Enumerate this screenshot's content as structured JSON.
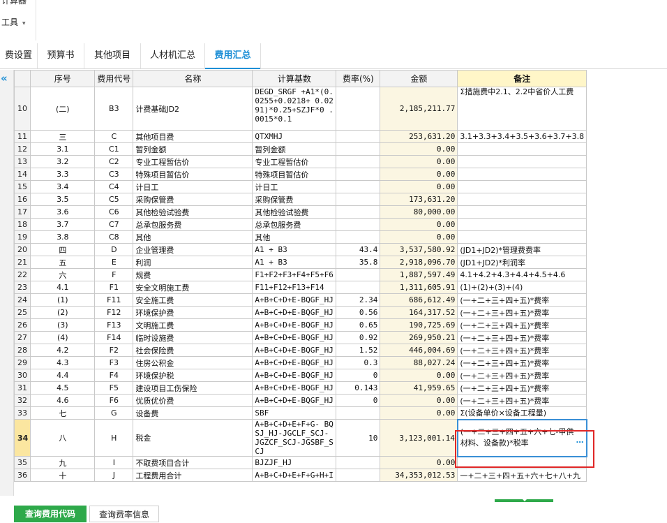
{
  "ribbon": {
    "cut_label": "计算器",
    "tools_label": "工具",
    "tools_caret": "▾"
  },
  "tabs": [
    {
      "label": "费设置"
    },
    {
      "label": "预算书"
    },
    {
      "label": "其他项目"
    },
    {
      "label": "人材机汇总"
    },
    {
      "label": "费用汇总"
    }
  ],
  "collapse_icon": "«",
  "grid": {
    "headers": [
      "序号",
      "费用代号",
      "名称",
      "计算基数",
      "费率(%)",
      "金额",
      "备注"
    ],
    "rows": [
      {
        "rn": "10",
        "seq": "(二)",
        "code": "B3",
        "name": "计费基础JD2",
        "base": "DEGD_SRGF +A1*(0.0255+0.0218+ 0.0291)*0.25+SZJF*0 .0015*0.1",
        "rate": "",
        "amount": "2,185,211.77",
        "remark": "Σ措施费中2.1、2.2中省价人工费"
      },
      {
        "rn": "11",
        "seq": "三",
        "code": "C",
        "name": "其他项目费",
        "base": "QTXMHJ",
        "rate": "",
        "amount": "253,631.20",
        "remark": "3.1+3.3+3.4+3.5+3.6+3.7+3.8"
      },
      {
        "rn": "12",
        "seq": "3.1",
        "code": "C1",
        "name": "暂列金额",
        "base": "暂列金额",
        "rate": "",
        "amount": "0.00",
        "remark": ""
      },
      {
        "rn": "13",
        "seq": "3.2",
        "code": "C2",
        "name": "专业工程暂估价",
        "base": "专业工程暂估价",
        "rate": "",
        "amount": "0.00",
        "remark": ""
      },
      {
        "rn": "14",
        "seq": "3.3",
        "code": "C3",
        "name": "特殊项目暂估价",
        "base": "特殊项目暂估价",
        "rate": "",
        "amount": "0.00",
        "remark": ""
      },
      {
        "rn": "15",
        "seq": "3.4",
        "code": "C4",
        "name": "计日工",
        "base": "计日工",
        "rate": "",
        "amount": "0.00",
        "remark": ""
      },
      {
        "rn": "16",
        "seq": "3.5",
        "code": "C5",
        "name": "采购保管费",
        "base": "采购保管费",
        "rate": "",
        "amount": "173,631.20",
        "remark": ""
      },
      {
        "rn": "17",
        "seq": "3.6",
        "code": "C6",
        "name": "其他检验试验费",
        "base": "其他检验试验费",
        "rate": "",
        "amount": "80,000.00",
        "remark": ""
      },
      {
        "rn": "18",
        "seq": "3.7",
        "code": "C7",
        "name": "总承包服务费",
        "base": "总承包服务费",
        "rate": "",
        "amount": "0.00",
        "remark": ""
      },
      {
        "rn": "19",
        "seq": "3.8",
        "code": "C8",
        "name": "其他",
        "base": "其他",
        "rate": "",
        "amount": "0.00",
        "remark": ""
      },
      {
        "rn": "20",
        "seq": "四",
        "code": "D",
        "name": "企业管理费",
        "base": "A1 + B3",
        "rate": "43.4",
        "amount": "3,537,580.92",
        "remark": "(JD1+JD2)*管理费费率"
      },
      {
        "rn": "21",
        "seq": "五",
        "code": "E",
        "name": "利润",
        "base": "A1 + B3",
        "rate": "35.8",
        "amount": "2,918,096.70",
        "remark": "(JD1+JD2)*利润率"
      },
      {
        "rn": "22",
        "seq": "六",
        "code": "F",
        "name": "规费",
        "base": "F1+F2+F3+F4+F5+F6",
        "rate": "",
        "amount": "1,887,597.49",
        "remark": "4.1+4.2+4.3+4.4+4.5+4.6"
      },
      {
        "rn": "23",
        "seq": "4.1",
        "code": "F1",
        "name": "安全文明施工费",
        "base": "F11+F12+F13+F14",
        "rate": "",
        "amount": "1,311,605.91",
        "remark": "(1)+(2)+(3)+(4)"
      },
      {
        "rn": "24",
        "seq": "(1)",
        "code": "F11",
        "name": "安全施工费",
        "base": "A+B+C+D+E-BQGF_HJ",
        "rate": "2.34",
        "amount": "686,612.49",
        "remark": "(一+二+三+四+五)*费率"
      },
      {
        "rn": "25",
        "seq": "(2)",
        "code": "F12",
        "name": "环境保护费",
        "base": "A+B+C+D+E-BQGF_HJ",
        "rate": "0.56",
        "amount": "164,317.52",
        "remark": "(一+二+三+四+五)*费率"
      },
      {
        "rn": "26",
        "seq": "(3)",
        "code": "F13",
        "name": "文明施工费",
        "base": "A+B+C+D+E-BQGF_HJ",
        "rate": "0.65",
        "amount": "190,725.69",
        "remark": "(一+二+三+四+五)*费率"
      },
      {
        "rn": "27",
        "seq": "(4)",
        "code": "F14",
        "name": "临时设施费",
        "base": "A+B+C+D+E-BQGF_HJ",
        "rate": "0.92",
        "amount": "269,950.21",
        "remark": "(一+二+三+四+五)*费率"
      },
      {
        "rn": "28",
        "seq": "4.2",
        "code": "F2",
        "name": "社会保险费",
        "base": "A+B+C+D+E-BQGF_HJ",
        "rate": "1.52",
        "amount": "446,004.69",
        "remark": "(一+二+三+四+五)*费率"
      },
      {
        "rn": "29",
        "seq": "4.3",
        "code": "F3",
        "name": "住房公积金",
        "base": "A+B+C+D+E-BQGF_HJ",
        "rate": "0.3",
        "amount": "88,027.24",
        "remark": "(一+二+三+四+五)*费率"
      },
      {
        "rn": "30",
        "seq": "4.4",
        "code": "F4",
        "name": "环境保护税",
        "base": "A+B+C+D+E-BQGF_HJ",
        "rate": "0",
        "amount": "0.00",
        "remark": "(一+二+三+四+五)*费率"
      },
      {
        "rn": "31",
        "seq": "4.5",
        "code": "F5",
        "name": "建设项目工伤保险",
        "base": "A+B+C+D+E-BQGF_HJ",
        "rate": "0.143",
        "amount": "41,959.65",
        "remark": "(一+二+三+四+五)*费率"
      },
      {
        "rn": "32",
        "seq": "4.6",
        "code": "F6",
        "name": "优质优价费",
        "base": "A+B+C+D+E-BQGF_HJ",
        "rate": "0",
        "amount": "0.00",
        "remark": "(一+二+三+四+五)*费率"
      },
      {
        "rn": "33",
        "seq": "七",
        "code": "G",
        "name": "设备费",
        "base": "SBF",
        "rate": "",
        "amount": "0.00",
        "remark": "Σ(设备单价×设备工程量)"
      },
      {
        "rn": "34",
        "seq": "八",
        "code": "H",
        "name": "税金",
        "base": "A+B+C+D+E+F+G- BQSJ_HJ-JGCLF_SCJ- JGZCF_SCJ-JGSBF_SCJ",
        "rate": "10",
        "amount": "3,123,001.14",
        "remark": "(一+二+三+四+五+六+七-甲供材料、设备款)*税率"
      },
      {
        "rn": "35",
        "seq": "九",
        "code": "I",
        "name": "不取费项目合计",
        "base": "BJZJF_HJ",
        "rate": "",
        "amount": "0.00",
        "remark": ""
      },
      {
        "rn": "36",
        "seq": "十",
        "code": "J",
        "name": "工程费用合计",
        "base": "A+B+C+D+E+F+G+H+I",
        "rate": "",
        "amount": "34,353,012.53",
        "remark": "一+二+三+四+五+六+七+八+九"
      }
    ],
    "edit_dots": "…"
  },
  "bottom_tabs": [
    {
      "label": "查询费用代码"
    },
    {
      "label": "查询费率信息"
    }
  ],
  "colors": {
    "accent": "#1e8fd6",
    "highlight_box": "#e02626",
    "active_bottom_tab": "#2ea94a",
    "remark_header": "#fff6c8"
  }
}
